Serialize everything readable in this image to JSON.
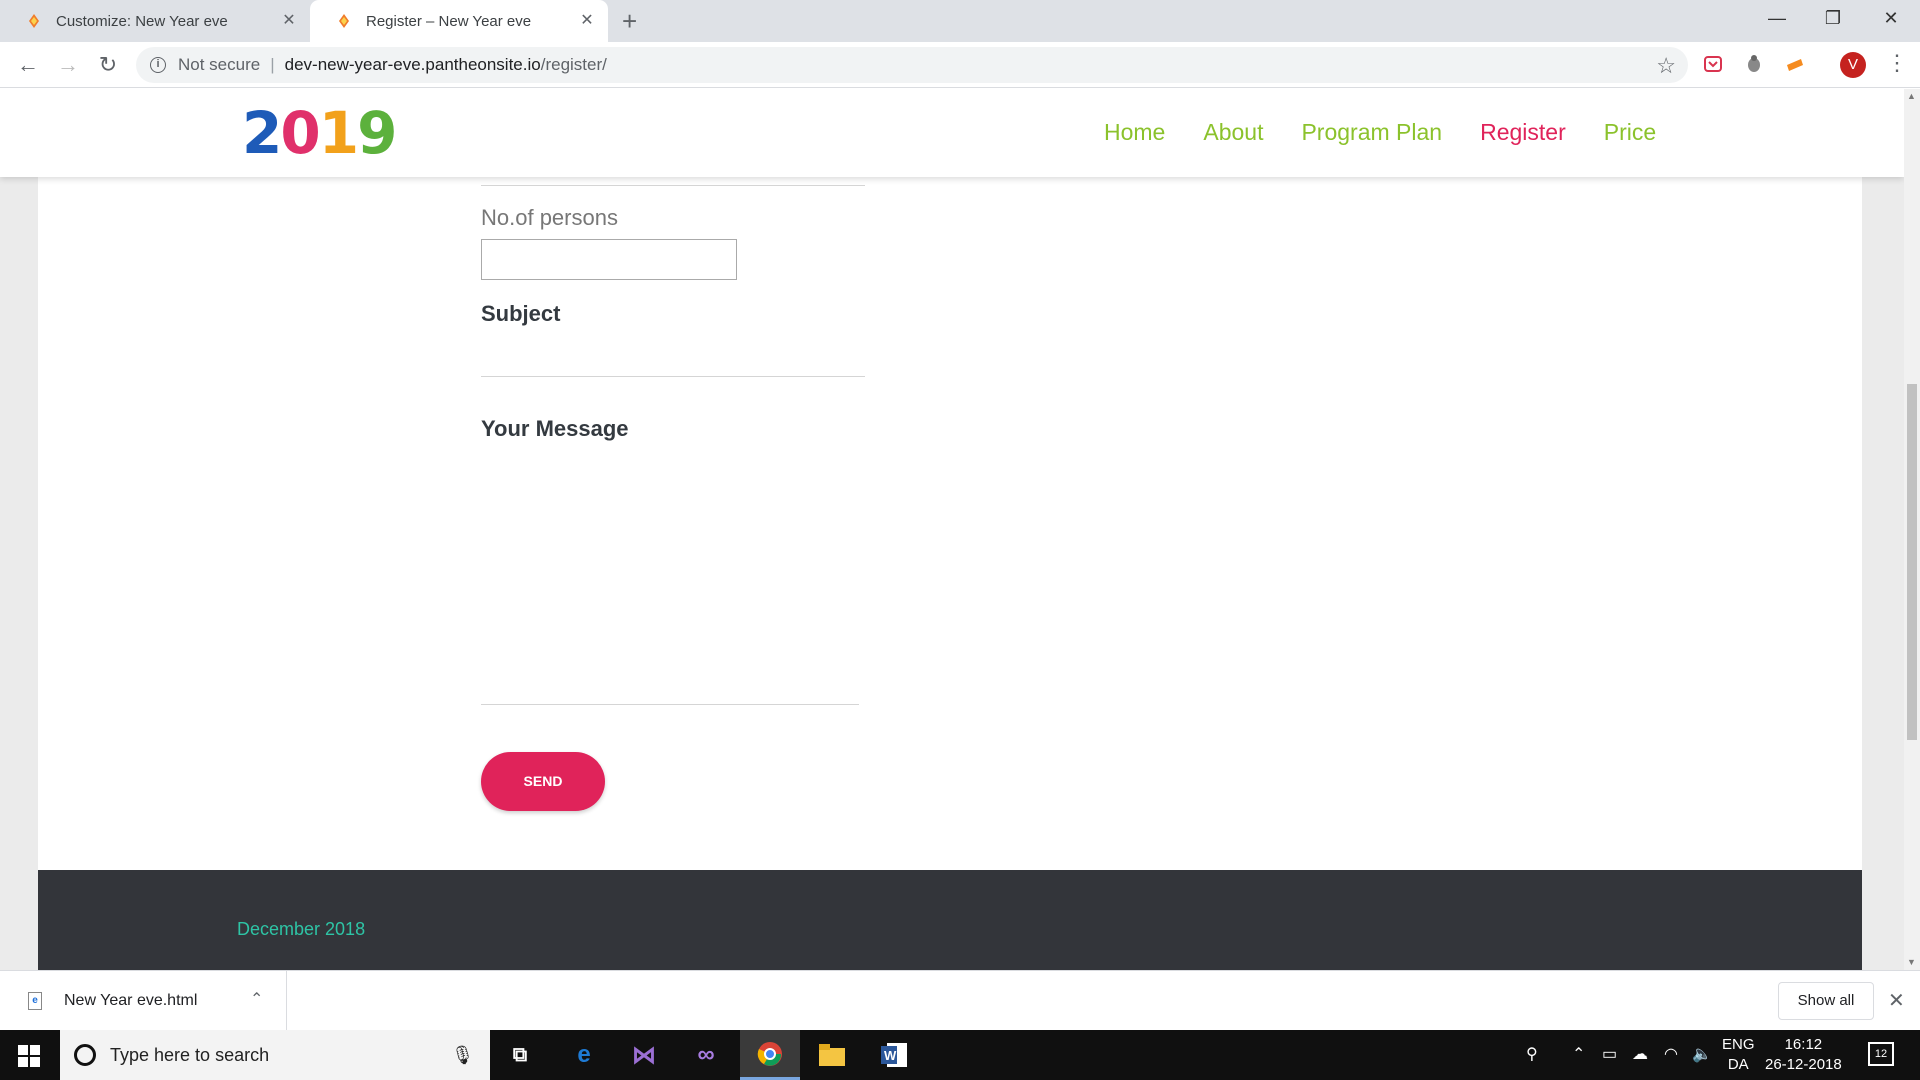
{
  "browser": {
    "tabs": [
      {
        "label": "Customize: New Year eve"
      },
      {
        "label": "Register – New Year eve"
      }
    ],
    "omnibox": {
      "security_text": "Not secure",
      "host": "dev-new-year-eve.pantheonsite.io",
      "path": "/register/"
    },
    "avatar_letter": "V"
  },
  "site": {
    "logo": {
      "d1": "2",
      "d2": "0",
      "d3": "1",
      "d4": "9"
    },
    "nav": [
      {
        "label": "Home"
      },
      {
        "label": "About"
      },
      {
        "label": "Program Plan"
      },
      {
        "label": "Register",
        "active": true
      },
      {
        "label": "Price"
      }
    ],
    "form": {
      "persons_label": "No.of persons",
      "persons_value": "",
      "subject_label": "Subject",
      "message_label": "Your Message",
      "send_label": "SEND"
    },
    "footer": {
      "date_text": "December 2018"
    }
  },
  "downloads": {
    "file_name": "New Year eve.html",
    "show_all_label": "Show all"
  },
  "taskbar": {
    "search_placeholder": "Type here to search",
    "lang_top": "ENG",
    "lang_bottom": "DA",
    "time": "16:12",
    "date": "26-12-2018",
    "notification_count": "12"
  },
  "colors": {
    "nav_green": "#8bc22c",
    "accent_pink": "#e0235a",
    "footer_bg": "#33353a",
    "footer_text": "#2ec4a5"
  }
}
